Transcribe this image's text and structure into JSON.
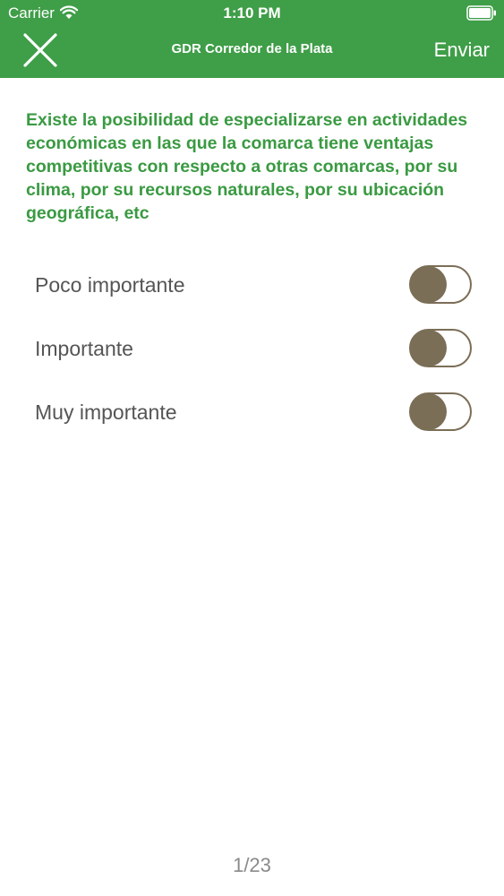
{
  "status_bar": {
    "carrier": "Carrier",
    "time": "1:10 PM",
    "wifi_icon": "wifi-icon",
    "battery_icon": "battery-icon"
  },
  "nav": {
    "close_icon": "close-icon",
    "title": "GDR Corredor de la Plata",
    "send_label": "Enviar"
  },
  "question": {
    "text": "Existe la posibilidad de especializarse en actividades económicas en las que la comarca tiene ventajas competitivas con respecto a otras comarcas, por su clima, por su recursos naturales, por su ubicación geográfica, etc"
  },
  "options": [
    {
      "label": "Poco importante",
      "checked": false
    },
    {
      "label": "Importante",
      "checked": false
    },
    {
      "label": "Muy importante",
      "checked": false
    }
  ],
  "pagination": {
    "text": "1/23"
  },
  "colors": {
    "brand_green": "#3f9e48",
    "question_green": "#3a9a42",
    "toggle_khaki": "#7b6e57"
  }
}
